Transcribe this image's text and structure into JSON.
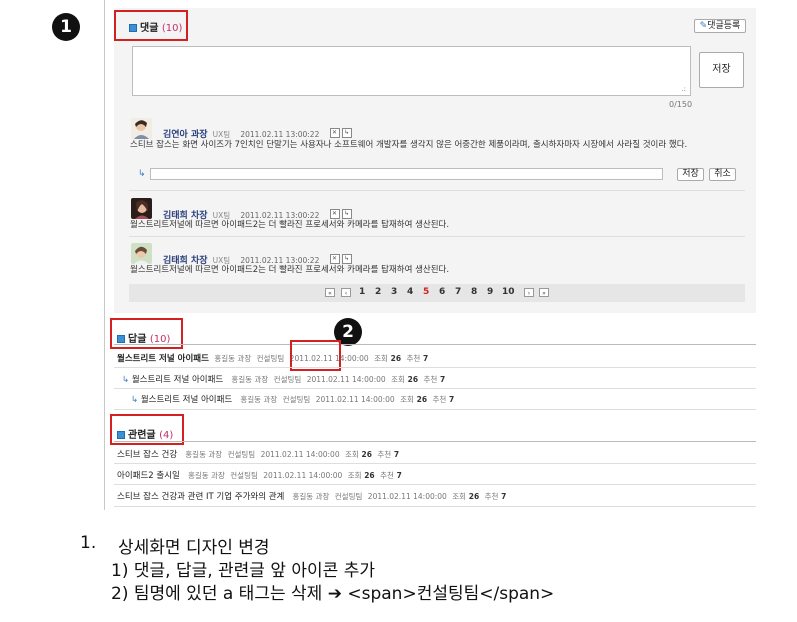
{
  "badges": {
    "one": "1",
    "two": "2"
  },
  "comments_section": {
    "title": "댓글",
    "count": "(10)",
    "register_button": "댓글등록",
    "save_button": "저장",
    "char_counter": "0/150",
    "comments": [
      {
        "author": "김연아 과장",
        "team": "UX팀",
        "timestamp": "2011.02.11 13:00:22",
        "text": "스티브 잡스는 화면 사이즈가 7인치인 단말기는 사용자나 소프트웨어 개발자를 생각지 않은 어중간한 제품이라며, 출시하자마자 시장에서 사라질 것이라 했다.",
        "reply_save": "저장",
        "reply_cancel": "취소"
      },
      {
        "author": "김태희 차장",
        "team": "UX팀",
        "timestamp": "2011.02.11 13:00:22",
        "text": "월스트리트저널에 따르면 아이패드2는 더 빨라진 프로세서와 카메라를 탑재하여 생산된다."
      },
      {
        "author": "김태희 차장",
        "team": "UX팀",
        "timestamp": "2011.02.11 13:00:22",
        "text": "월스트리트저널에 따르면 아이패드2는 더 빨라진 프로세서와 카메라를 탑재하여 생산된다."
      }
    ],
    "pagination": [
      "1",
      "2",
      "3",
      "4",
      "5",
      "6",
      "7",
      "8",
      "9",
      "10"
    ],
    "current_page": "5"
  },
  "replies_section": {
    "title": "답글",
    "count": "(10)",
    "items": [
      {
        "title": "월스트리트 저널 아이패드",
        "author": "홍길동 과장",
        "team": "컨설팅팀",
        "date": "2011.02.11 14:00:00",
        "views_label": "조회",
        "views": "26",
        "recommend_label": "추천",
        "recommend": "7"
      },
      {
        "title": "월스트리트 저널 아이패드",
        "author": "홍길동 과장",
        "team": "컨설팅팀",
        "date": "2011.02.11 14:00:00",
        "views_label": "조회",
        "views": "26",
        "recommend_label": "추천",
        "recommend": "7"
      },
      {
        "title": "월스트리트 저널 아이패드",
        "author": "홍길동 과장",
        "team": "컨설팅팀",
        "date": "2011.02.11 14:00:00",
        "views_label": "조회",
        "views": "26",
        "recommend_label": "추천",
        "recommend": "7"
      }
    ]
  },
  "related_section": {
    "title": "관련글",
    "count": "(4)",
    "items": [
      {
        "title": "스티브 잡스 건강",
        "author": "홍길동 과장",
        "team": "컨설팅팀",
        "date": "2011.02.11 14:00:00",
        "views_label": "조회",
        "views": "26",
        "recommend_label": "추천",
        "recommend": "7"
      },
      {
        "title": "아이패드2 출시일",
        "author": "홍길동 과장",
        "team": "컨설팅팀",
        "date": "2011.02.11 14:00:00",
        "views_label": "조회",
        "views": "26",
        "recommend_label": "추천",
        "recommend": "7"
      },
      {
        "title": "스티브 잡스 건강과 관련 IT 기업 주가와의 관계",
        "author": "홍길동 과장",
        "team": "컨설팅팀",
        "date": "2011.02.11 14:00:00",
        "views_label": "조회",
        "views": "26",
        "recommend_label": "추천",
        "recommend": "7"
      }
    ]
  },
  "notes": {
    "num": "1.",
    "heading": "상세화면 디자인 변경",
    "line1": "1) 댓글, 답글, 관련글 앞 아이콘 추가",
    "line2_prefix": "2) 팀명에 있던 a 태그는 삭제",
    "line2_arrow": "➔",
    "line2_code": "<span>컨설팅팀</span>"
  },
  "colors": {
    "annotation_red": "#d32020",
    "count_pink": "#c0306a",
    "author_navy": "#2a3f7a",
    "reply_arrow_blue": "#3a78c0"
  }
}
